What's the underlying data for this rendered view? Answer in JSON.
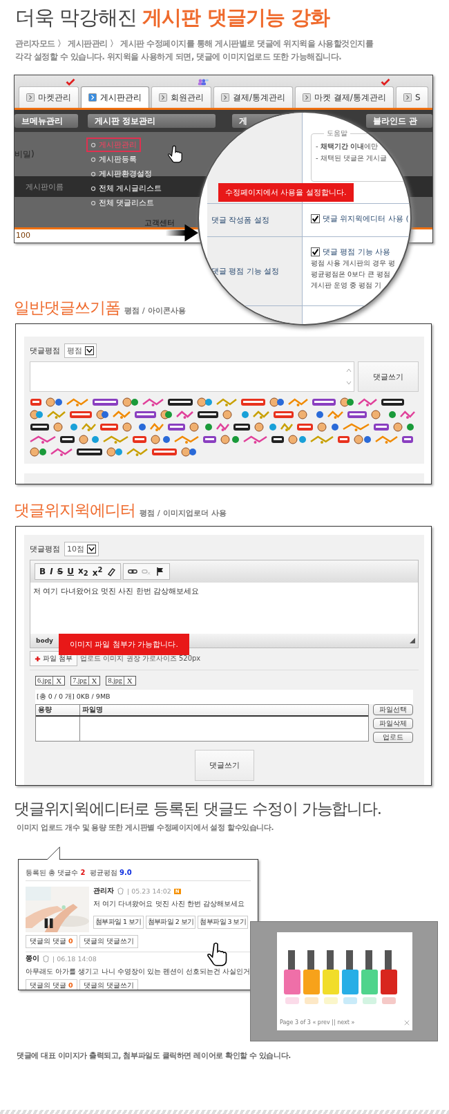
{
  "header": {
    "title_plain": "더욱 막강해진",
    "title_accent": "게시판 댓글기능 강화",
    "description": [
      "관리자모드 〉 게시판관리 〉 게시판 수정페이지를 통해 게시판별로 댓글에 위지윅을 사용할것인지를",
      "각각 설정할 수 있습니다. 위지윅을 사용하게 되면, 댓글에 이미지업로드 또한 가능해집니다."
    ]
  },
  "admin_screenshot": {
    "tabs": [
      {
        "label": "마켓관리",
        "selected": false,
        "checked": true,
        "members": false
      },
      {
        "label": "게시판관리",
        "selected": true,
        "checked": false,
        "members": false
      },
      {
        "label": "회원관리",
        "selected": false,
        "checked": false,
        "members": true
      },
      {
        "label": "결제/통계관리",
        "selected": false,
        "checked": false,
        "members": false
      },
      {
        "label": "마켓 결제/통계관리",
        "selected": false,
        "checked": true,
        "members": false
      },
      {
        "label": "S",
        "selected": false,
        "checked": false,
        "members": false
      }
    ],
    "menu_headers": [
      "브메뉴관리",
      "게시판 정보관리",
      "게",
      "블라인드 관"
    ],
    "submenu": [
      {
        "label": "게시판관리",
        "selected": true
      },
      {
        "label": "게시판등록",
        "selected": false
      },
      {
        "label": "게시판환경설정",
        "selected": false
      },
      {
        "label": "전체 게시글리스트",
        "selected": false
      },
      {
        "label": "전체 댓글리스트",
        "selected": false
      }
    ],
    "left_fragment": "비밀)",
    "table_column": "게시판이름",
    "row_values": [
      "100",
      "고객센터"
    ],
    "zoom": {
      "help_title": "도움말",
      "help_lines": [
        "- **채택기간 이내**에만",
        "- 채택된 댓글은 게시글"
      ],
      "tooltip": "수정페이지에서 사용을 설정합니다.",
      "settings": [
        {
          "label": "댓글 작성폼 설정",
          "option": "댓글 위지윅에디터 사용 (",
          "checked": true
        },
        {
          "label": "댓글 평점 기능 설정",
          "option": "댓글 평점 기능 사용",
          "checked": true,
          "notes": [
            "평점 사용 게시판의 경우 평",
            "평균평점은 0보다 큰 평점",
            "게시판 운영 중 평점 기"
          ]
        }
      ]
    }
  },
  "basic_form": {
    "title": "일반댓글쓰기폼",
    "subtitle": "평점 / 아이콘사용",
    "rating_label": "댓글평점",
    "rating_value": "평점",
    "submit": "댓글쓰기"
  },
  "wysiwyg_form": {
    "title": "댓글위지윅에디터",
    "subtitle": "평점 / 이미지업로더 사용",
    "rating_label": "댓글평점",
    "rating_value": "10점",
    "toolbar_buttons": [
      "B",
      "I",
      "S",
      "U",
      "x$_{2}$",
      "x$^{2}$"
    ],
    "editor_text": "저 여기 다녀왔어요 멋진 사진 한번 감상해보세요",
    "path": "body",
    "tooltip": "이미지 파일 첨부가 가능합니다.",
    "attach_button": "파일 첨부",
    "attach_hint": "업로드 이미지 권장 가로사이즈 520px",
    "files": [
      {
        "name": "6.jpg",
        "remove": "X"
      },
      {
        "name": "7.jpg",
        "remove": "X"
      },
      {
        "name": "8.jpg",
        "remove": "X"
      }
    ],
    "summary": "[총 0 / 0 개] 0KB / 9MB",
    "columns": [
      "용량",
      "파일명"
    ],
    "file_buttons": [
      "파일선택",
      "파일삭제",
      "업로드"
    ],
    "submit": "댓글쓰기"
  },
  "comments_demo": {
    "title": "댓글위지윅에디터로 등록된 댓글도 수정이 가능합니다.",
    "note": "이미지 **업로드 개수 및 용량** 또한 게시판별 수정페이지에서 설정 할수있습니다.",
    "count_label": "등록된 총 댓글수",
    "count": "2",
    "avg_label": "평균평점",
    "avg": "9.0",
    "comments": [
      {
        "author": "관리자",
        "date": "| 05.23 14:02",
        "new_badge": "N",
        "text": "저 여기 다녀왔어요 멋진 사진 한번 감상해보세요",
        "has_image": true,
        "attachments": [
          "첨부파일 1 보기",
          "첨부파일 2 보기",
          "첨부파일 3 보기"
        ],
        "reply_label": "댓글의 댓글",
        "reply_count": "0",
        "write_reply": "댓글의 댓글쓰기"
      },
      {
        "author": "쫑이",
        "date": "| 06.18 14:08",
        "text": "아무래도 아가를 생기고 나니 수영장이 있는 펜션이 선호되는건 사실인거",
        "has_image": false,
        "reply_label": "댓글의 댓글",
        "reply_count": "0",
        "write_reply": "댓글의 댓글쓰기"
      }
    ],
    "popup_pager": "Page 3 of 3  « prev || next »"
  },
  "footer": "댓글에 대표 이미지가 출력되고, 첨부파일도 클릭하면 레이어로 확인할 수 있습니다."
}
